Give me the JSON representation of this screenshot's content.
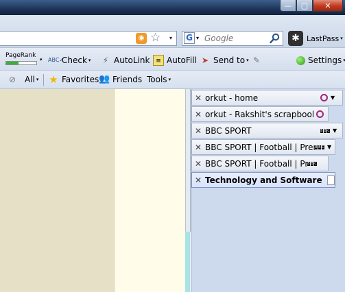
{
  "window": {
    "buttons": {
      "minimize": "—",
      "maximize": "▢",
      "close": "✕"
    }
  },
  "navbar": {
    "search": {
      "placeholder": "Google",
      "engine_letter": "G"
    },
    "lastpass_label": "LastPass",
    "rss_glyph": "◉",
    "star_glyph": "☆",
    "dropdown_glyph": "▾"
  },
  "toolbar": {
    "pagerank_label": "PageRank",
    "check_label": "Check",
    "autolink_label": "AutoLink",
    "autofill_label": "AutoFill",
    "sendto_label": "Send to",
    "settings_label": "Settings"
  },
  "bookmarks_bar": {
    "all_label": "All",
    "favorites_label": "Favorites",
    "friends_label": "Friends",
    "tools_label": "Tools"
  },
  "tabs": [
    {
      "title": "orkut - home",
      "icon": "orkut-icon",
      "has_dropdown": true
    },
    {
      "title": "orkut - Rakshit's scrapbook",
      "icon": "orkut-icon",
      "has_dropdown": false
    },
    {
      "title": "BBC SPORT",
      "icon": "bbc-icon",
      "has_dropdown": true
    },
    {
      "title": "BBC SPORT | Football | Prem...",
      "icon": "bbc-icon",
      "has_dropdown": true
    },
    {
      "title": "BBC SPORT | Football | Pre...",
      "icon": "bbc-icon",
      "has_dropdown": false
    },
    {
      "title": "Technology and Software Re...",
      "icon": "page-icon",
      "has_dropdown": false,
      "active": true
    }
  ],
  "tab_close_glyph": "✕",
  "colors": {
    "page_background": "#e6e0c7",
    "tab_panel": "#cdd9ed",
    "active_tab_border": "#7f93c4",
    "orkut_icon": "#a1237a"
  }
}
